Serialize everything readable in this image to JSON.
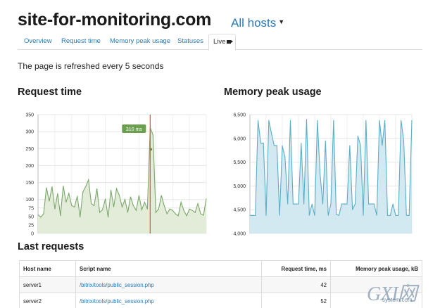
{
  "header": {
    "site_title": "site-for-monitoring.com",
    "hosts_dropdown": "All hosts"
  },
  "tabs": [
    {
      "label": "Overview",
      "active": false
    },
    {
      "label": "Request time",
      "active": false
    },
    {
      "label": "Memory peak usage",
      "active": false
    },
    {
      "label": "Statuses",
      "active": false
    },
    {
      "label": "Live",
      "active": true
    }
  ],
  "refresh_note": "The page is refreshed every 5 seconds",
  "panels": {
    "request_time_title": "Request time",
    "memory_title": "Memory peak usage"
  },
  "chart_data": [
    {
      "type": "area",
      "title": "Request time",
      "xlabel": "",
      "ylabel": "",
      "ylim": [
        0,
        350
      ],
      "yticks": [
        "0",
        "25",
        "50",
        "75",
        "100",
        "150",
        "200",
        "250",
        "300",
        "350"
      ],
      "ytick_values": [
        0,
        25,
        50,
        75,
        100,
        150,
        200,
        250,
        300,
        350
      ],
      "grid": true,
      "color": "#7aa86a",
      "fill": "#e3ecd9",
      "marker": {
        "index": 40,
        "label": "310 ms",
        "value": 310,
        "color": "#e8594a",
        "label_color": "#6aa04e"
      },
      "x": [
        0,
        1,
        2,
        3,
        4,
        5,
        6,
        7,
        8,
        9,
        10,
        11,
        12,
        13,
        14,
        15,
        16,
        17,
        18,
        19,
        20,
        21,
        22,
        23,
        24,
        25,
        26,
        27,
        28,
        29,
        30,
        31,
        32,
        33,
        34,
        35,
        36,
        37,
        38,
        39,
        40,
        41,
        42,
        43,
        44,
        45,
        46,
        47,
        48,
        49,
        50,
        51,
        52,
        53,
        54,
        55,
        56,
        57,
        58,
        59,
        60
      ],
      "values": [
        55,
        48,
        58,
        135,
        95,
        138,
        72,
        118,
        52,
        140,
        92,
        118,
        82,
        78,
        110,
        48,
        122,
        138,
        158,
        88,
        82,
        132,
        62,
        70,
        102,
        48,
        128,
        78,
        132,
        112,
        78,
        100,
        62,
        108,
        82,
        68,
        112,
        70,
        92,
        72,
        312,
        290,
        62,
        72,
        112,
        82,
        58,
        72,
        68,
        58,
        52,
        92,
        68,
        52,
        72,
        68,
        62,
        88,
        58,
        54,
        102
      ]
    },
    {
      "type": "area",
      "title": "Memory peak usage",
      "xlabel": "",
      "ylabel": "",
      "ylim": [
        4000,
        6500
      ],
      "yticks": [
        "4,000",
        "4,500",
        "5,000",
        "5,500",
        "6,000",
        "6,500"
      ],
      "ytick_values": [
        4000,
        4500,
        5000,
        5500,
        6000,
        6500
      ],
      "grid": true,
      "color": "#5aaec8",
      "fill": "#d2e9f1",
      "x": [
        0,
        1,
        2,
        3,
        4,
        5,
        6,
        7,
        8,
        9,
        10,
        11,
        12,
        13,
        14,
        15,
        16,
        17,
        18,
        19,
        20,
        21,
        22,
        23,
        24,
        25,
        26,
        27,
        28,
        29,
        30,
        31,
        32,
        33,
        34,
        35,
        36,
        37,
        38,
        39,
        40,
        41,
        42,
        43,
        44,
        45,
        46,
        47,
        48,
        49,
        50,
        51,
        52,
        53,
        54,
        55,
        56,
        57,
        58,
        59,
        60
      ],
      "values": [
        4380,
        4380,
        4380,
        6380,
        5900,
        5900,
        4380,
        6380,
        6100,
        5850,
        5850,
        4380,
        5850,
        5600,
        4620,
        6380,
        4620,
        4620,
        4620,
        5900,
        4620,
        6400,
        4380,
        4620,
        4380,
        6380,
        5250,
        4620,
        5950,
        4380,
        4620,
        6380,
        4400,
        4380,
        4620,
        4620,
        4620,
        5850,
        4500,
        4620,
        6050,
        5850,
        4380,
        6380,
        4620,
        4620,
        4620,
        4380,
        6380,
        5850,
        6380,
        4380,
        4380,
        4620,
        4380,
        4380,
        6380,
        5950,
        4380,
        4380,
        6380
      ]
    }
  ],
  "last_requests": {
    "title": "Last requests",
    "columns": [
      "Host name",
      "Script name",
      "Request time, ms",
      "Memory peak usage, kB"
    ],
    "rows": [
      {
        "host": "server1",
        "script": "/bitrix/tools/public_session.php",
        "time": "42",
        "memory": ""
      },
      {
        "host": "server2",
        "script": "/bitrix/tools/public_session.php",
        "time": "52",
        "memory": ""
      }
    ]
  },
  "watermark": {
    "big": "GXI网",
    "small": "system.com"
  }
}
